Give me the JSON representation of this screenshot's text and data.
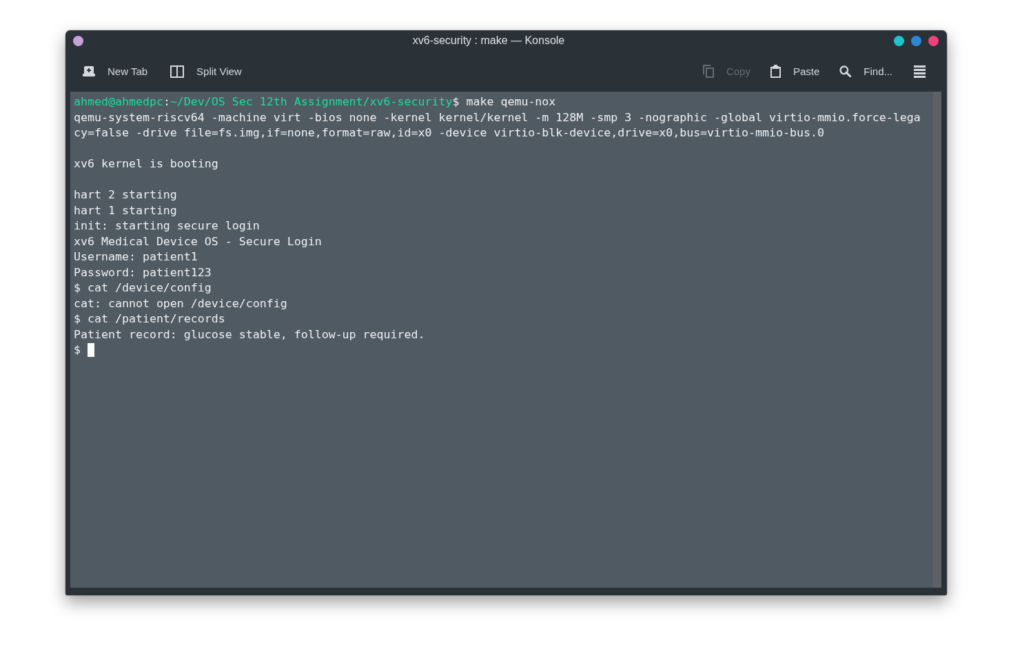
{
  "window": {
    "title": "xv6-security : make — Konsole",
    "buttons": [
      {
        "kind": "menu",
        "color": "#c8a3d9"
      },
      {
        "kind": "minimize",
        "color": "#1dc6cf"
      },
      {
        "kind": "maximize",
        "color": "#2b87d6"
      },
      {
        "kind": "close",
        "color": "#f0417c"
      }
    ]
  },
  "toolbar": {
    "left": [
      {
        "kind": "newtab",
        "label": "New Tab",
        "disabled": false
      },
      {
        "kind": "split",
        "label": "Split View",
        "disabled": false
      }
    ],
    "right": [
      {
        "kind": "copy",
        "label": "Copy",
        "disabled": true
      },
      {
        "kind": "paste",
        "label": "Paste",
        "disabled": false
      },
      {
        "kind": "find",
        "label": "Find...",
        "disabled": false
      },
      {
        "kind": "menu",
        "disabled": false
      }
    ]
  },
  "terminal": {
    "cursor": true,
    "lines": [
      {
        "kind": "prompt",
        "segments": [
          {
            "text": "ahmed@ahmedpc",
            "color": "#1cdc9a"
          },
          {
            "text": ":",
            "color": "#eff0f1"
          },
          {
            "text": "~/Dev/OS Sec 12th Assignment/xv6-security",
            "color": "#1cdc9a"
          },
          {
            "text": "$ make qemu-nox",
            "color": "#eff0f1"
          }
        ]
      },
      {
        "kind": "output",
        "text": "qemu-system-riscv64 -machine virt -bios none -kernel kernel/kernel -m 128M -smp 3 -nographic -global virtio-mmio.force-lega"
      },
      {
        "kind": "output",
        "text": "cy=false -drive file=fs.img,if=none,format=raw,id=x0 -device virtio-blk-device,drive=x0,bus=virtio-mmio-bus.0"
      },
      {
        "kind": "blank"
      },
      {
        "kind": "output",
        "text": "xv6 kernel is booting"
      },
      {
        "kind": "blank"
      },
      {
        "kind": "output",
        "text": "hart 2 starting"
      },
      {
        "kind": "output",
        "text": "hart 1 starting"
      },
      {
        "kind": "output",
        "text": "init: starting secure login"
      },
      {
        "kind": "output",
        "text": "xv6 Medical Device OS - Secure Login"
      },
      {
        "kind": "output",
        "text": "Username: patient1"
      },
      {
        "kind": "output",
        "text": "Password: patient123"
      },
      {
        "kind": "output",
        "text": "$ cat /device/config"
      },
      {
        "kind": "output",
        "text": "cat: cannot open /device/config"
      },
      {
        "kind": "output",
        "text": "$ cat /patient/records"
      },
      {
        "kind": "output",
        "text": "Patient record: glucose stable, follow-up required."
      },
      {
        "kind": "output",
        "text": "$"
      }
    ]
  }
}
